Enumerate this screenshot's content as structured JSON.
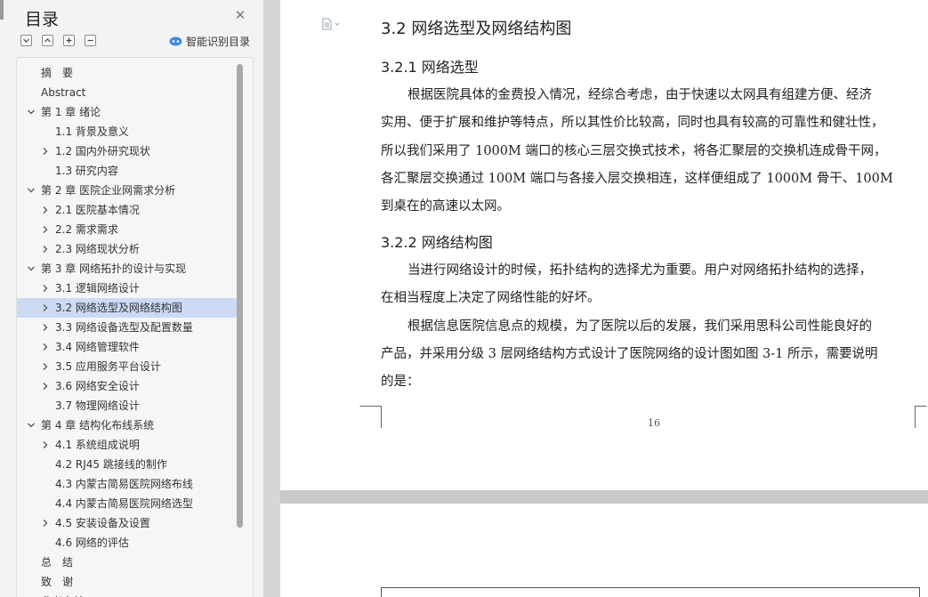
{
  "toc": {
    "title": "目录",
    "smart_label": "智能识别目录",
    "tools": [
      "collapse-all",
      "expand-up",
      "add-heading",
      "remove-heading"
    ],
    "items": [
      {
        "label": "摘　要",
        "level": 0,
        "chevron": "none",
        "selected": false
      },
      {
        "label": "Abstract",
        "level": 0,
        "chevron": "none",
        "selected": false
      },
      {
        "label": "第 1 章  绪论",
        "level": 0,
        "chevron": "down",
        "selected": false
      },
      {
        "label": "1.1  背景及意义",
        "level": 1,
        "chevron": "none",
        "selected": false
      },
      {
        "label": "1.2  国内外研究现状",
        "level": 1,
        "chevron": "right",
        "selected": false
      },
      {
        "label": "1.3 研究内容",
        "level": 1,
        "chevron": "none",
        "selected": false
      },
      {
        "label": "第 2 章  医院企业网需求分析",
        "level": 0,
        "chevron": "down",
        "selected": false
      },
      {
        "label": "2.1 医院基本情况",
        "level": 1,
        "chevron": "right",
        "selected": false
      },
      {
        "label": "2.2 需求需求",
        "level": 1,
        "chevron": "right",
        "selected": false
      },
      {
        "label": "2.3 网络现状分析",
        "level": 1,
        "chevron": "right",
        "selected": false
      },
      {
        "label": "第 3 章  网络拓扑的设计与实现",
        "level": 0,
        "chevron": "down",
        "selected": false
      },
      {
        "label": "3.1 逻辑网络设计",
        "level": 1,
        "chevron": "right",
        "selected": false
      },
      {
        "label": "3.2 网络选型及网络结构图",
        "level": 1,
        "chevron": "right",
        "selected": true
      },
      {
        "label": "3.3 网络设备选型及配置数量",
        "level": 1,
        "chevron": "right",
        "selected": false
      },
      {
        "label": "3.4 网络管理软件",
        "level": 1,
        "chevron": "right",
        "selected": false
      },
      {
        "label": "3.5 应用服务平台设计",
        "level": 1,
        "chevron": "right",
        "selected": false
      },
      {
        "label": "3.6 网络安全设计",
        "level": 1,
        "chevron": "right",
        "selected": false
      },
      {
        "label": "3.7 物理网络设计",
        "level": 1,
        "chevron": "none",
        "selected": false
      },
      {
        "label": "第 4 章  结构化布线系统",
        "level": 0,
        "chevron": "down",
        "selected": false
      },
      {
        "label": "4.1 系统组成说明",
        "level": 1,
        "chevron": "right",
        "selected": false
      },
      {
        "label": "4.2 RJ45 跳接线的制作",
        "level": 1,
        "chevron": "none",
        "selected": false
      },
      {
        "label": "4.3 内蒙古简易医院网络布线",
        "level": 1,
        "chevron": "none",
        "selected": false
      },
      {
        "label": "4.4 内蒙古简易医院网络选型",
        "level": 1,
        "chevron": "none",
        "selected": false
      },
      {
        "label": "4.5 安装设备及设置",
        "level": 1,
        "chevron": "right",
        "selected": false
      },
      {
        "label": "4.6 网络的评估",
        "level": 1,
        "chevron": "none",
        "selected": false
      },
      {
        "label": "总　结",
        "level": 0,
        "chevron": "none",
        "selected": false
      },
      {
        "label": "致　谢",
        "level": 0,
        "chevron": "none",
        "selected": false
      },
      {
        "label": "参考文献",
        "level": 0,
        "chevron": "none",
        "selected": false
      }
    ]
  },
  "document": {
    "section_heading": "3.2 网络选型及网络结构图",
    "sub1_heading": "3.2.1 网络选型",
    "sub1_lines": [
      "根据医院具体的金费投入情况，经综合考虑，由于快速以太网具有组建方便、经济",
      "实用、便于扩展和维护等特点，所以其性价比较高，同时也具有较高的可靠性和健壮性，",
      "所以我们采用了 1000M 端口的核心三层交换式技术，将各汇聚层的交换机连成骨干网，",
      "各汇聚层交换通过 100M 端口与各接入层交换相连，这样便组成了 1000M 骨干、100M",
      "到桌在的高速以太网。"
    ],
    "sub2_heading": "3.2.2 网络结构图",
    "sub2_lines": [
      "当进行网络设计的时候，拓扑结构的选择尤为重要。用户对网络拓扑结构的选择，",
      "在相当程度上决定了网络性能的好坏。",
      "根据信息医院信息点的规模，为了医院以后的发展，我们采用思科公司性能良好的",
      "产品，并采用分级 3 层网络结构方式设计了医院网络的设计图如图 3-1 所示，需要说明",
      "的是："
    ],
    "page_number": "16"
  }
}
